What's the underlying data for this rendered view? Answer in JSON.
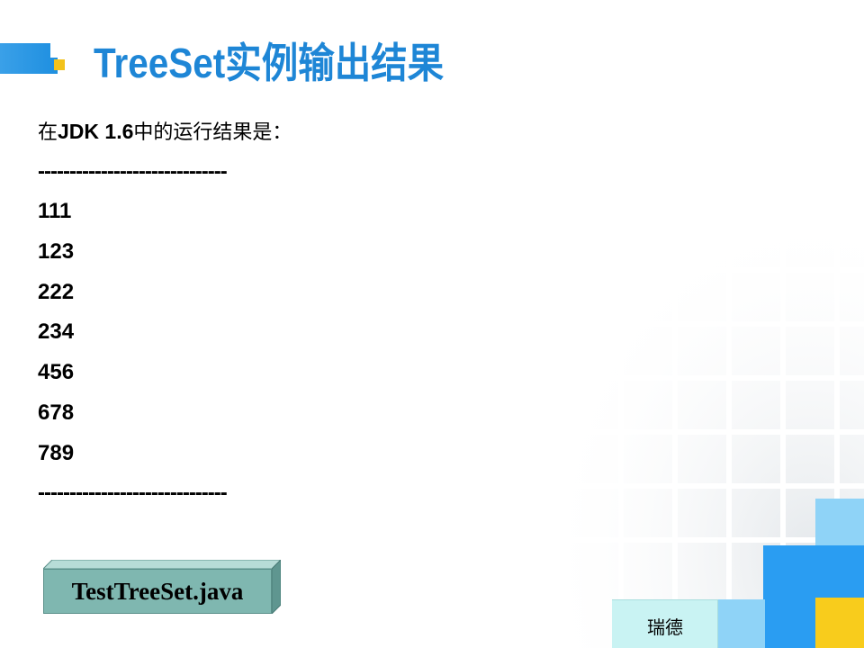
{
  "header": {
    "title": "TreeSet实例输出结果"
  },
  "content": {
    "intro": {
      "prefix": "在",
      "bold": "JDK 1.6",
      "suffix": "中的运行结果是："
    },
    "separator": "------------------------------",
    "values": [
      "111",
      "123",
      "222",
      "234",
      "456",
      "678",
      "789"
    ]
  },
  "file_box": {
    "label": "TestTreeSet.java"
  },
  "footer": {
    "label": "瑞德"
  },
  "colors": {
    "title": "#1e86d6",
    "accent_blue": "#1e8fe0",
    "accent_yellow": "#f2c21b",
    "file_box": "#7fb7b0",
    "footer_bg": "#c9f3f3",
    "block_light_blue": "#8fd3f7",
    "block_blue": "#2a9df2"
  }
}
